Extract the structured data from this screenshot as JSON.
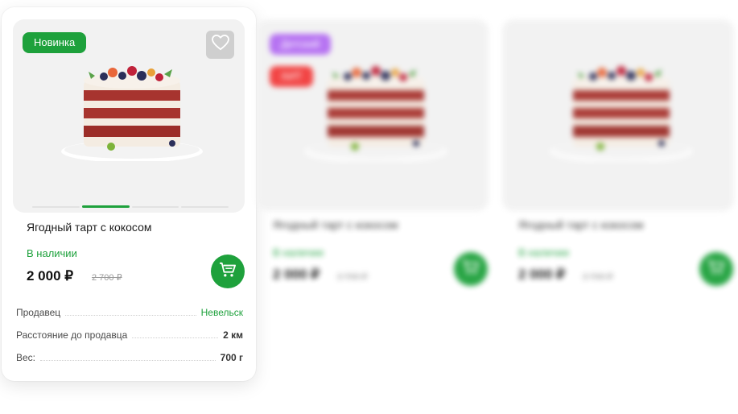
{
  "colors": {
    "accent_green": "#1ea13c",
    "badge_purple": "#b36cf2",
    "badge_red": "#f23c3c"
  },
  "product_cards": [
    {
      "badges": [
        "Новинка"
      ],
      "title": "Ягодный тарт с кокосом",
      "availability": "В наличии",
      "price": "2 000 ₽",
      "old_price": "2 700 ₽",
      "image_dots": 4,
      "active_dot": 1,
      "specs": [
        {
          "label": "Продавец",
          "value": "Невельск"
        },
        {
          "label": "Расстояние до продавца",
          "value": "2 км"
        },
        {
          "label": "Вес:",
          "value": "700 г"
        }
      ],
      "icons": {
        "favorite": "heart-icon",
        "cart": "cart-icon"
      }
    },
    {
      "badges": [
        "Детский",
        "ХИТ"
      ],
      "title": "Ягодный тарт с кокосом",
      "availability": "В наличии",
      "price": "2 000 ₽",
      "old_price": "2 700 ₽"
    },
    {
      "badges": [],
      "title": "Ягодный тарт с кокосом",
      "availability": "В наличии",
      "price": "2 000 ₽",
      "old_price": "2 700 ₽"
    }
  ]
}
